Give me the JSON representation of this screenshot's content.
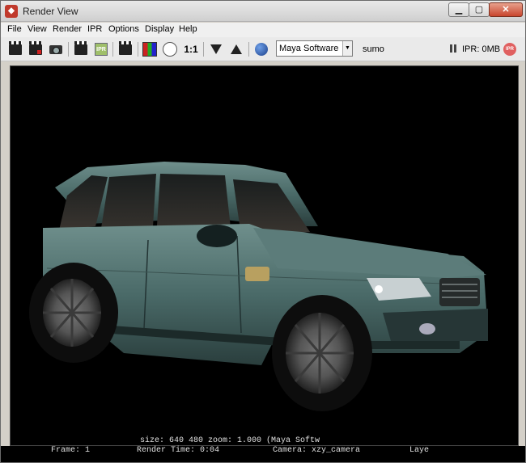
{
  "window": {
    "title": "Render View",
    "title_icon": "maya-icon"
  },
  "menu": [
    "File",
    "View",
    "Render",
    "IPR",
    "Options",
    "Display",
    "Help"
  ],
  "toolbar": {
    "ratio_label": "1:1",
    "renderer": "Maya Software",
    "camera_name": "sumo",
    "ipr_memory": "IPR: 0MB",
    "ipr_stop_label": "IPR",
    "ipr_button_label": "IPR"
  },
  "render_info": {
    "text": "size:  640  480 zoom: 1.000      (Maya Softw"
  },
  "status_bar": {
    "frame": "Frame: 1",
    "render_time": "Render Time: 0:04",
    "camera": "Camera: xzy_camera",
    "layer": "Laye"
  }
}
